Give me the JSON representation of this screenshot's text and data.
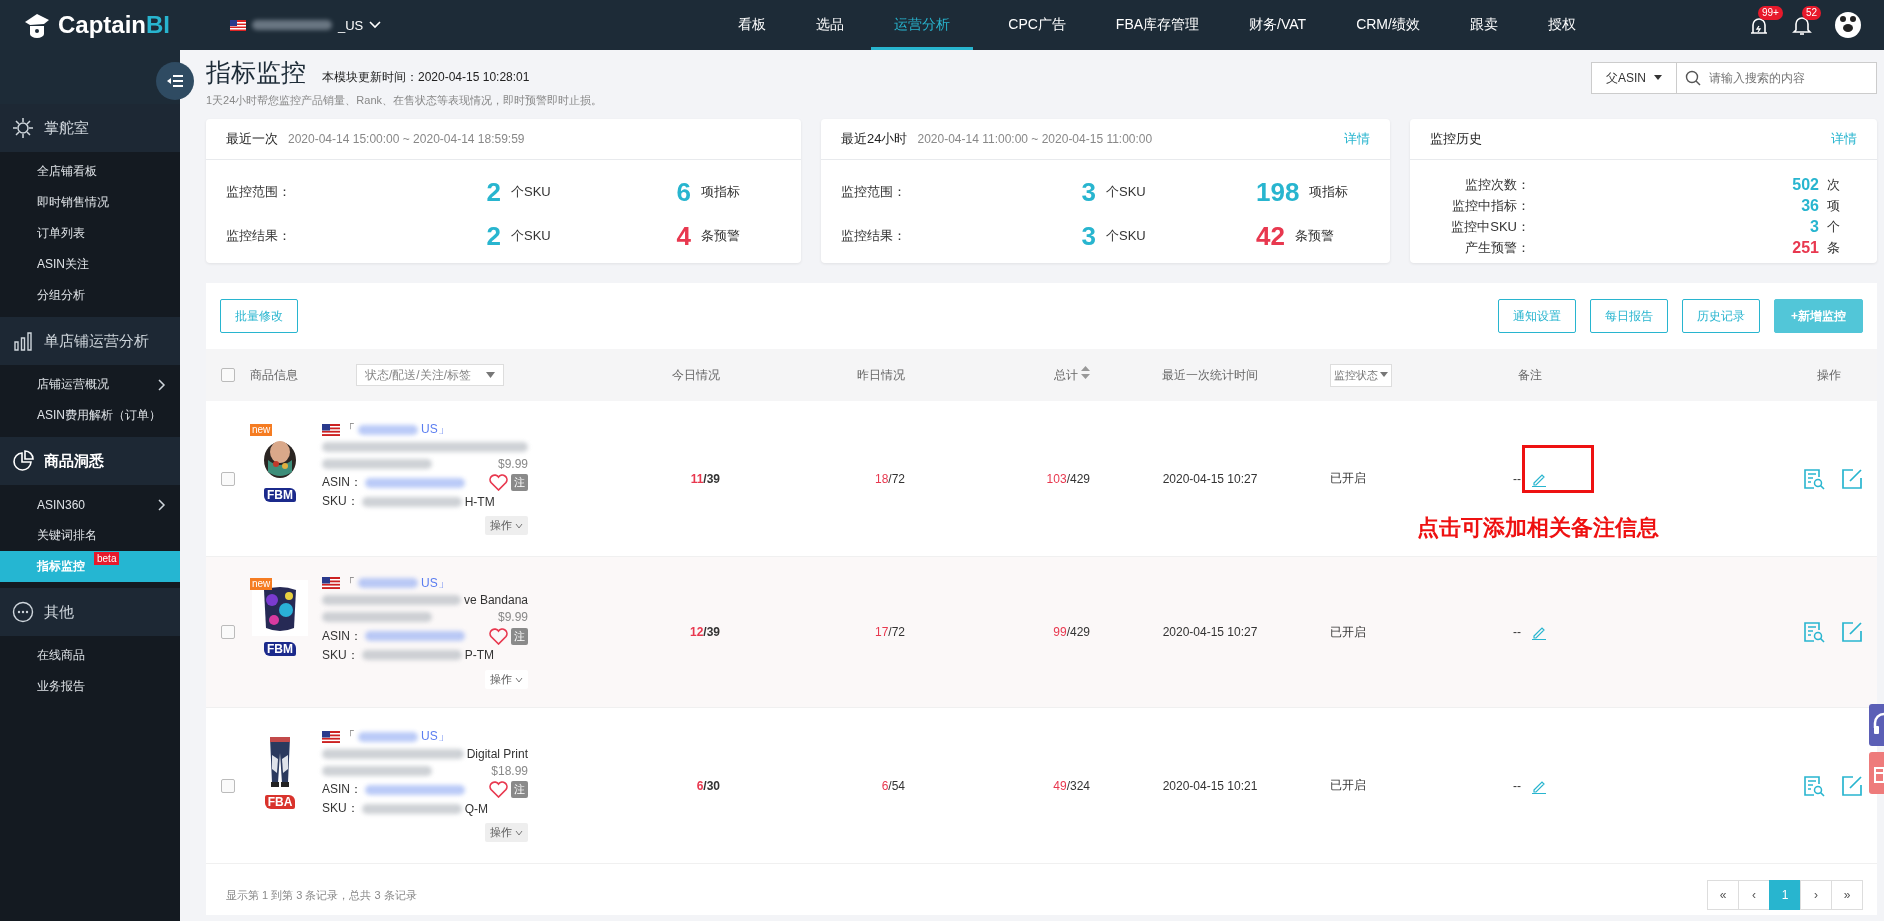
{
  "topbar": {
    "logo_text": "Captain",
    "logo_accent": "BI",
    "store_suffix": "_US",
    "nav": [
      {
        "label": "看板",
        "selected": false
      },
      {
        "label": "选品",
        "selected": false
      },
      {
        "label": "运营分析",
        "selected": true
      },
      {
        "label": "CPC广告",
        "selected": false
      },
      {
        "label": "FBA库存管理",
        "selected": false
      },
      {
        "label": "财务/VAT",
        "selected": false
      },
      {
        "label": "CRM/绩效",
        "selected": false
      },
      {
        "label": "跟卖",
        "selected": false
      },
      {
        "label": "授权",
        "selected": false
      }
    ],
    "alert_count": "99+",
    "notice_count": "52"
  },
  "sidebar": {
    "groups": [
      {
        "label": "掌舵室",
        "items": [
          {
            "label": "全店铺看板",
            "selected": false,
            "expandable": false
          },
          {
            "label": "即时销售情况",
            "selected": false,
            "expandable": false
          },
          {
            "label": "订单列表",
            "selected": false,
            "expandable": false
          },
          {
            "label": "ASIN关注",
            "selected": false,
            "expandable": false
          },
          {
            "label": "分组分析",
            "selected": false,
            "expandable": false
          }
        ]
      },
      {
        "label": "单店铺运营分析",
        "items": [
          {
            "label": "店铺运营概况",
            "selected": false,
            "expandable": true
          },
          {
            "label": "ASIN费用解析（订单）",
            "selected": false,
            "expandable": false
          }
        ]
      },
      {
        "label": "商品洞悉",
        "items": [
          {
            "label": "ASIN360",
            "selected": false,
            "expandable": true
          },
          {
            "label": "关键词排名",
            "selected": false,
            "expandable": false
          },
          {
            "label": "指标监控",
            "selected": true,
            "expandable": false,
            "badge": "beta"
          }
        ]
      },
      {
        "label": "其他",
        "items": [
          {
            "label": "在线商品",
            "selected": false,
            "expandable": false
          },
          {
            "label": "业务报告",
            "selected": false,
            "expandable": false
          }
        ]
      }
    ]
  },
  "page": {
    "title": "指标监控",
    "updated": "本模块更新时间：2020-04-15 10:28:01",
    "subtitle": "1天24小时帮您监控产品销量、Rank、在售状态等表现情况，即时预警即时止损。",
    "search": {
      "scope": "父ASIN",
      "placeholder": "请输入搜索的内容"
    }
  },
  "cards": [
    {
      "title": "最近一次",
      "range": "2020-04-14 15:00:00 ~ 2020-04-14 18:59:59",
      "rows": [
        {
          "label": "监控范围：",
          "value": "2",
          "unit": "个SKU",
          "value2": "6",
          "unit2": "项指标",
          "alert2": false
        },
        {
          "label": "监控结果：",
          "value": "2",
          "unit": "个SKU",
          "value2": "4",
          "unit2": "条预警",
          "alert2": true
        }
      ]
    },
    {
      "title": "最近24小时",
      "range": "2020-04-14 11:00:00 ~ 2020-04-15 11:00:00",
      "link": "详情",
      "rows": [
        {
          "label": "监控范围：",
          "value": "3",
          "unit": "个SKU",
          "value2": "198",
          "unit2": "项指标",
          "alert2": false
        },
        {
          "label": "监控结果：",
          "value": "3",
          "unit": "个SKU",
          "value2": "42",
          "unit2": "条预警",
          "alert2": true
        }
      ]
    }
  ],
  "history": {
    "title": "监控历史",
    "link": "详情",
    "rows": [
      {
        "label": "监控次数：",
        "value": "502",
        "unit": "次",
        "alert": false
      },
      {
        "label": "监控中指标：",
        "value": "36",
        "unit": "项",
        "alert": false
      },
      {
        "label": "监控中SKU：",
        "value": "3",
        "unit": "个",
        "alert": false
      },
      {
        "label": "产生预警：",
        "value": "251",
        "unit": "条",
        "alert": true
      }
    ]
  },
  "toolbar": {
    "left": "批量修改",
    "right": [
      {
        "label": "通知设置",
        "kind": "outline"
      },
      {
        "label": "每日报告",
        "kind": "outline"
      },
      {
        "label": "历史记录",
        "kind": "outline"
      },
      {
        "label": "+新增监控",
        "kind": "solid"
      }
    ]
  },
  "table": {
    "select_all": false,
    "columns": {
      "product": "商品信息",
      "filter": "状态/配送/关注/标签",
      "today": "今日情况",
      "yesterday": "昨日情况",
      "total": "总计",
      "time": "最近一次统计时间",
      "status": "监控状态",
      "remark": "备注",
      "actions": "操作"
    },
    "rows": [
      {
        "checked": false,
        "new_badge": "new",
        "fulfillment": {
          "label": "FBM",
          "kind": "merchant"
        },
        "store_open": "「",
        "store_close": "US」",
        "price": "$9.99",
        "asin_label": "ASIN：",
        "sku_label": "SKU：",
        "sku_tail": "H-TM",
        "note_tag": "注",
        "action": "操作",
        "today": {
          "hit": "11",
          "total": "/39"
        },
        "yesterday": {
          "hit": "18",
          "total": "/72"
        },
        "total": {
          "hit": "103",
          "total": "/429"
        },
        "time": "2020-04-15 10:27",
        "status": "已开启",
        "remark": "--",
        "highlight": false
      },
      {
        "checked": false,
        "new_badge": "new",
        "fulfillment": {
          "label": "FBM",
          "kind": "merchant"
        },
        "store_open": "「",
        "store_close": "US」",
        "title_visible": "ve Bandana",
        "price": "$9.99",
        "asin_label": "ASIN：",
        "sku_label": "SKU：",
        "sku_tail": "P-TM",
        "note_tag": "注",
        "action": "操作",
        "today": {
          "hit": "12",
          "total": "/39"
        },
        "yesterday": {
          "hit": "17",
          "total": "/72"
        },
        "total": {
          "hit": "99",
          "total": "/429"
        },
        "time": "2020-04-15 10:27",
        "status": "已开启",
        "remark": "--",
        "highlight": true
      },
      {
        "checked": false,
        "fulfillment": {
          "label": "FBA",
          "kind": "amazon"
        },
        "store_open": "「",
        "store_close": "US」",
        "title_visible": "Digital Print",
        "price": "$18.99",
        "asin_label": "ASIN：",
        "sku_label": "SKU：",
        "sku_tail": "Q-M",
        "note_tag": "注",
        "action": "操作",
        "today": {
          "hit": "6",
          "total": "/30"
        },
        "yesterday": {
          "hit": "6",
          "total": "/54"
        },
        "total": {
          "hit": "49",
          "total": "/324"
        },
        "time": "2020-04-15 10:21",
        "status": "已开启",
        "remark": "--",
        "highlight": false
      }
    ],
    "footer": "显示第 1 到第 3 条记录，总共 3 条记录",
    "pages": [
      {
        "label": "«",
        "selected": false
      },
      {
        "label": "‹",
        "selected": false
      },
      {
        "label": "1",
        "selected": true
      },
      {
        "label": "›",
        "selected": false
      },
      {
        "label": "»",
        "selected": false
      }
    ]
  },
  "annotation": {
    "text": "点击可添加相关备注信息"
  }
}
